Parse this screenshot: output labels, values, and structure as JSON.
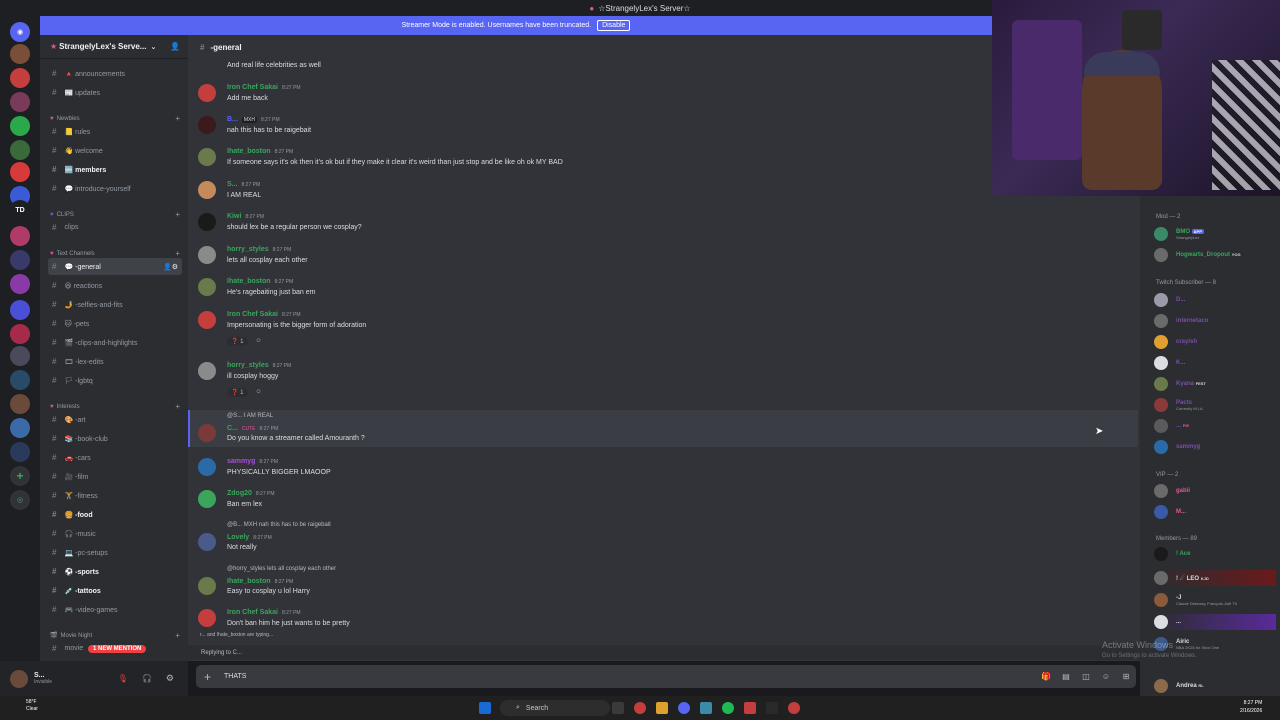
{
  "titlebar": {
    "title": "☆StrangelyLex's Server☆"
  },
  "banner": {
    "text": "Streamer Mode is enabled. Usernames have been truncated.",
    "disable_label": "Disable"
  },
  "rail": {
    "td_label": "TD"
  },
  "server": {
    "name": "StrangelyLex's Serve..."
  },
  "sidebar": {
    "channels_top": [
      {
        "label": "🔺 announcements"
      },
      {
        "label": "📰 updates"
      }
    ],
    "cat_newbies": "Newbies",
    "newbies": [
      {
        "label": "📒 rules"
      },
      {
        "label": "👋 welcome"
      },
      {
        "label": "🆕 members"
      },
      {
        "label": "💬 introduce-yourself"
      }
    ],
    "cat_clips": "CLIPS",
    "clips": [
      {
        "label": "clips"
      }
    ],
    "cat_text": "Text Channels",
    "text": [
      {
        "label": "💬 -general"
      },
      {
        "label": "😆 reactions"
      },
      {
        "label": "🤳 -selfies-and-fits"
      },
      {
        "label": "🐱 -pets"
      },
      {
        "label": "🎬 -clips-and-highlights"
      },
      {
        "label": "🎞 -lex-edits"
      },
      {
        "label": "🏳 -lgbtq"
      }
    ],
    "cat_interests": "Interests",
    "interests": [
      {
        "label": "🎨 -art"
      },
      {
        "label": "📚 -book-club"
      },
      {
        "label": "🚗 -cars"
      },
      {
        "label": "🎥 -film"
      },
      {
        "label": "🏋 -fitness"
      },
      {
        "label": "🍔 -food"
      },
      {
        "label": "🎧 -music"
      },
      {
        "label": "💻 -pc-setups"
      },
      {
        "label": "⚽ -sports"
      },
      {
        "label": "💉 -tattoos"
      },
      {
        "label": "🎮 -video-games"
      }
    ],
    "cat_movie": "Movie Night",
    "movie": {
      "label": "movie"
    },
    "mention_badge": "1 NEW MENTION"
  },
  "user": {
    "name": "S...",
    "status": "Invisible"
  },
  "channel": {
    "name": "-general"
  },
  "messages": [
    {
      "text": "And real life celebrities as well"
    },
    {
      "user": "Iron Chef Sakai",
      "time": "8:27 PM",
      "text": "Add me back",
      "color": "#3ba55c"
    },
    {
      "user": "B...",
      "tag": "MXH",
      "time": "8:27 PM",
      "text": "nah this has to be raigebait",
      "color": "#5865f2"
    },
    {
      "user": "Ihate_boston",
      "time": "8:27 PM",
      "text": "If someone says it's ok then it's ok but if they make it clear it's weird than just stop and be like oh ok MY BAD",
      "color": "#3ba55c"
    },
    {
      "user": "S...",
      "time": "8:27 PM",
      "text": "I AM REAL",
      "color": "#3ba55c"
    },
    {
      "user": "Kiwi",
      "time": "8:27 PM",
      "text": "should lex be a regular person we cosplay?",
      "color": "#3ba55c"
    },
    {
      "user": "horry_styles",
      "time": "8:27 PM",
      "text": "lets all cosplay each other",
      "color": "#3ba55c"
    },
    {
      "user": "Ihate_boston",
      "time": "8:27 PM",
      "text": "He's ragebaiting just ban em",
      "color": "#3ba55c"
    },
    {
      "user": "Iron Chef Sakai",
      "time": "8:27 PM",
      "text": "Impersonating is the bigger form of adoration",
      "color": "#3ba55c",
      "react": "1"
    },
    {
      "user": "horry_styles",
      "time": "8:27 PM",
      "text": "ill cosplay hoggy",
      "color": "#3ba55c",
      "react": "1"
    },
    {
      "reply": "@S... I AM REAL",
      "user": "C...",
      "tag": "CUTE",
      "time": "8:27 PM",
      "text": "Do you know a streamer called Amouranth ?",
      "color": "#3ba55c"
    },
    {
      "user": "sammyg",
      "time": "8:27 PM",
      "text": "PHYSICALLY BIGGER LMAOOP",
      "color": "#a84edb"
    },
    {
      "user": "Zdog20",
      "time": "8:27 PM",
      "text": "Ban em lex",
      "color": "#3ba55c"
    },
    {
      "reply": "@B... MXH nah this has to be raigebait",
      "user": "Lovely",
      "time": "8:27 PM",
      "text": "Not really",
      "color": "#3ba55c"
    },
    {
      "reply": "@horry_styles lets all cosplay each other",
      "user": "Ihate_boston",
      "time": "8:27 PM",
      "text": "Easy to cosplay u lol Harry",
      "color": "#3ba55c"
    },
    {
      "user": "Iron Chef Sakai",
      "time": "8:27 PM",
      "text": "Don't ban him he just wants to be pretty",
      "color": "#3ba55c"
    }
  ],
  "typing": "r... and Ihate_boston are typing...",
  "reply_to": "Replying to C...",
  "input": {
    "value": "THATS"
  },
  "members": {
    "cat_mod": "Mod — 2",
    "mods": [
      {
        "name": "BMO",
        "badge": "APP",
        "sub": "StrangelyLex",
        "color": "#3ba55c"
      },
      {
        "name": "Hogwarts_Dropout",
        "badge": "YOG",
        "color": "#3ba55c"
      }
    ],
    "cat_twitch": "Twitch Subscriber — 8",
    "twitch": [
      {
        "name": "D...",
        "color": "#7a4fa8"
      },
      {
        "name": "internetaco",
        "color": "#7a4fa8"
      },
      {
        "name": "crayish",
        "color": "#7a4fa8"
      },
      {
        "name": "K...",
        "color": "#7a4fa8"
      },
      {
        "name": "Kyana",
        "badge": "FEST",
        "color": "#7a4fa8"
      },
      {
        "name": "Pacts",
        "sub": "Currently M.I.A",
        "color": "#7a4fa8"
      },
      {
        "name": "...",
        "badge": "PIE",
        "color": "#7a4fa8"
      },
      {
        "name": "sammyg",
        "color": "#7a4fa8"
      }
    ],
    "cat_vip": "VIP — 2",
    "vip": [
      {
        "name": "gabii",
        "color": "#e0559b"
      },
      {
        "name": "M...",
        "color": "#e0559b"
      }
    ],
    "cat_members": "Members — 89",
    "list": [
      {
        "name": "! Ace",
        "color": "#3ba55c"
      },
      {
        "name": "! ☄ LEO",
        "badge": "KJD",
        "color": "#dbdee1"
      },
      {
        "name": "-J",
        "sub": "Claude Debussy, François-Joël Th",
        "color": "#dbdee1"
      },
      {
        "name": "...",
        "color": "#dbdee1"
      },
      {
        "name": "Airic",
        "sub": "NBA 2K25 for Xbox One",
        "color": "#dbdee1"
      },
      {
        "name": "Andrea",
        "badge": "RL",
        "color": "#dbdee1"
      }
    ]
  },
  "watermark": {
    "title": "Activate Windows",
    "sub": "Go to Settings to activate Windows."
  },
  "taskbar": {
    "search": "Search",
    "time": "8:27 PM",
    "date": "2/16/2026",
    "temp": "58°F",
    "weather": "Clear"
  }
}
